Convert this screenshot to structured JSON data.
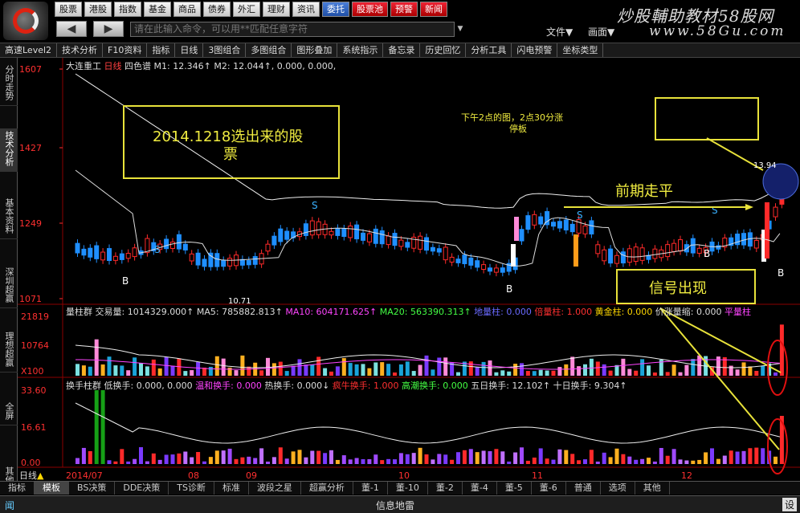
{
  "topbar": {
    "menu": [
      "股票",
      "港股",
      "指数",
      "基金",
      "商品",
      "债券",
      "外汇",
      "理财",
      "资讯",
      "委托",
      "股票池",
      "预警",
      "新闻"
    ],
    "brand": "炒股輔助教材58股网",
    "brand_url": "www.58Gu.com",
    "command_placeholder": "请在此输入命令，可以用**匹配任意字符",
    "file_menu": "文件▼",
    "view_menu": "画面▼",
    "back_icon": "back-arrow-icon",
    "forward_icon": "forward-arrow-icon"
  },
  "toolbar": [
    "高速Level2",
    "技术分析",
    "F10资料",
    "指标",
    "日线",
    "3图组合",
    "多图组合",
    "图形叠加",
    "系统指示",
    "备忘录",
    "历史回忆",
    "分析工具",
    "闪电预警",
    "坐标类型"
  ],
  "leftrail": [
    "分时走势",
    "技术分析",
    "基本资料",
    "深圳超赢",
    "理想超赢",
    "全屏",
    "其他"
  ],
  "main_panel": {
    "stock": "大连重工",
    "period": "日线",
    "indicator": "四色谱",
    "m1_label": "M1: 12.346↑",
    "m2_label": "M2: 12.044↑, 0.000, 0.000,",
    "price_ticks": [
      "1607",
      "1427",
      "1249",
      "1071"
    ],
    "low_label": "10.71",
    "high_label": "13.94",
    "annotation_left": "2014.1218选出来的股票",
    "annotation_top": "下午2点的图，2点30分涨停板",
    "annotation_flat": "前期走平",
    "annotation_signal": "信号出现"
  },
  "volume_panel": {
    "title": "量柱群",
    "vol": "交易量: 1014329.000↑",
    "ma5": "MA5: 785882.813↑",
    "ma10": "MA10: 604171.625↑",
    "ma20": "MA20: 563390.313↑",
    "extra1": "地量柱: 0.000",
    "extra2": "倍量柱: 1.000",
    "extra3": "黄金柱: 0.000",
    "extra4": "价涨量缩: 0.000",
    "extra5": "平量柱",
    "ticks": [
      "21819",
      "10764",
      "X100"
    ]
  },
  "turnover_panel": {
    "title": "换手柱群",
    "low": "低换手: 0.000, 0.000",
    "mild": "温和换手: 0.000",
    "hot": "热换手: 0.000↓",
    "crazy": "疯牛换手: 1.000",
    "tide": "高潮换手: 0.000",
    "five": "五日换手: 12.102↑",
    "ten": "十日换手: 9.304↑",
    "ticks": [
      "33.60",
      "16.61",
      "0.00"
    ]
  },
  "timeaxis": {
    "label": "日线",
    "dates": [
      "2014/07",
      "08",
      "09",
      "10",
      "11",
      "12"
    ]
  },
  "bottomtabs": [
    "指标",
    "模板",
    "BS决策",
    "DDE决策",
    "TS诊断",
    "标准",
    "波段之星",
    "超赢分析",
    "董-1",
    "董-10",
    "董-2",
    "董-4",
    "董-5",
    "董-6",
    "普通",
    "选项",
    "其他"
  ],
  "statusbar": {
    "left": "闻",
    "middle": "信息地雷",
    "right": "设"
  },
  "colors": {
    "up": "#ff2a2a",
    "down": "#1f8fff",
    "flat": "#ffffff",
    "accent": "#ffff33"
  }
}
